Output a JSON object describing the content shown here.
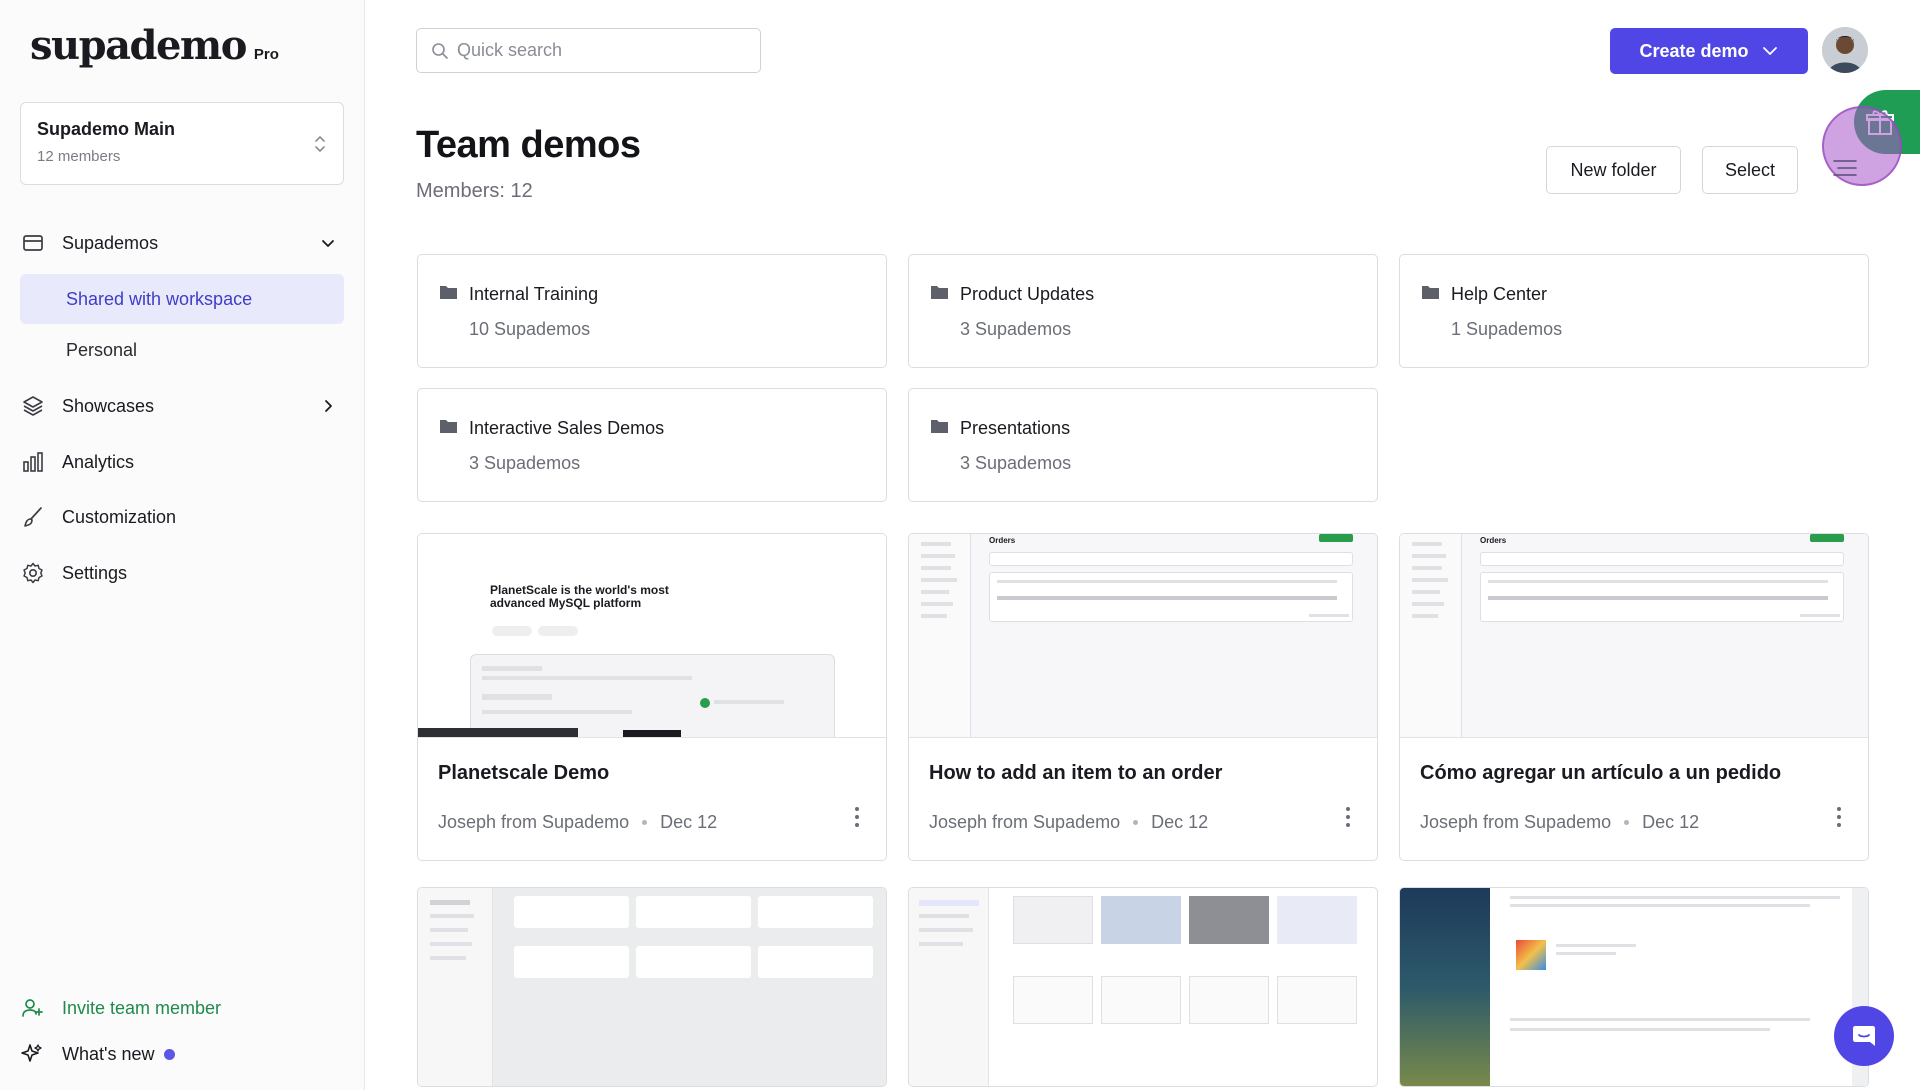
{
  "brand": {
    "name": "supademo",
    "plan": "Pro"
  },
  "workspace": {
    "name": "Supademo Main",
    "members": "12 members"
  },
  "sidebar": {
    "supademos": "Supademos",
    "sub_items": [
      "Shared with workspace",
      "Personal"
    ],
    "showcases": "Showcases",
    "analytics": "Analytics",
    "customization": "Customization",
    "settings": "Settings",
    "invite": "Invite team member",
    "whats_new": "What's new"
  },
  "search": {
    "placeholder": "Quick search"
  },
  "header": {
    "create_label": "Create demo"
  },
  "page": {
    "title": "Team demos",
    "subtitle": "Members: 12"
  },
  "actions": {
    "new_folder": "New folder",
    "select": "Select"
  },
  "folders": [
    {
      "name": "Internal Training",
      "count": "10 Supademos"
    },
    {
      "name": "Product Updates",
      "count": "3 Supademos"
    },
    {
      "name": "Help Center",
      "count": "1 Supademos"
    },
    {
      "name": "Interactive Sales Demos",
      "count": "3 Supademos"
    },
    {
      "name": "Presentations",
      "count": "3 Supademos"
    }
  ],
  "demos": [
    {
      "title": "Planetscale Demo",
      "author": "Joseph from Supademo",
      "date": "Dec 12",
      "thumb_headline": "PlanetScale is the world's most advanced MySQL platform"
    },
    {
      "title": "How to add an item to an order",
      "author": "Joseph from Supademo",
      "date": "Dec 12",
      "thumb_headline": "Orders"
    },
    {
      "title": "Cómo agregar un artículo a un pedido",
      "author": "Joseph from Supademo",
      "date": "Dec 12",
      "thumb_headline": "Orders"
    }
  ],
  "colors": {
    "accent": "#4f46e5",
    "active_bg": "#e8e9fb",
    "invite_green": "#1f8a4c",
    "gift_green": "#1f9d55"
  }
}
